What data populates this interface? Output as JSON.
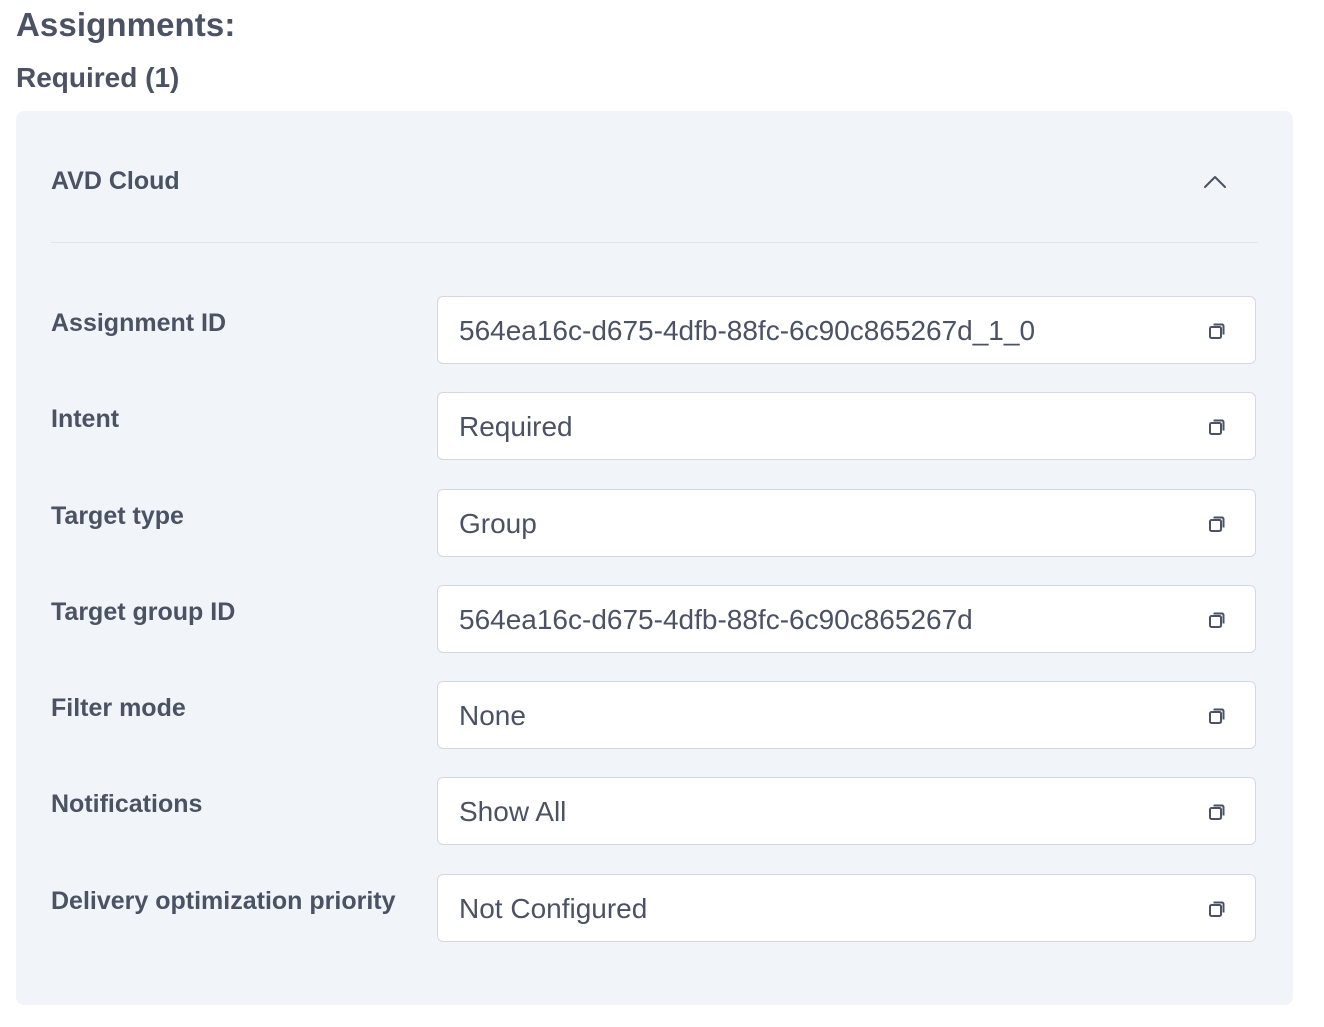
{
  "page": {
    "heading": "Assignments:"
  },
  "section": {
    "heading": "Required (1)"
  },
  "card": {
    "title": "AVD Cloud",
    "expanded_icon": "chevron-up-icon",
    "copy_icon": "copy-icon",
    "rows": [
      {
        "label": "Assignment ID",
        "value": "564ea16c-d675-4dfb-88fc-6c90c865267d_1_0"
      },
      {
        "label": "Intent",
        "value": "Required"
      },
      {
        "label": "Target type",
        "value": "Group"
      },
      {
        "label": "Target group ID",
        "value": "564ea16c-d675-4dfb-88fc-6c90c865267d"
      },
      {
        "label": "Filter mode",
        "value": "None"
      },
      {
        "label": "Notifications",
        "value": "Show All"
      },
      {
        "label": "Delivery optimization priority",
        "value": "Not Configured"
      }
    ]
  },
  "colors": {
    "text": "#4a5263",
    "card_background": "#f1f4f9",
    "field_border": "#d3d8e1",
    "field_background": "#ffffff"
  }
}
